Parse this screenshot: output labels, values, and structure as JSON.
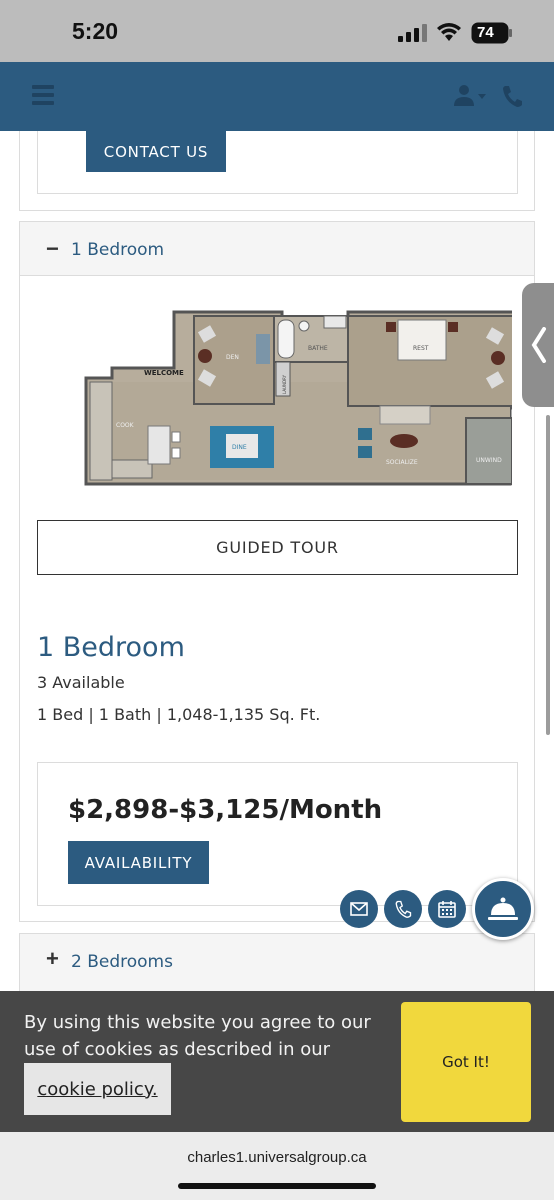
{
  "status_bar": {
    "time": "5:20",
    "battery": "74"
  },
  "contact_card": {
    "contact_label": "CONTACT US"
  },
  "accordion_1": {
    "sign": "−",
    "title": "1 Bedroom",
    "floorplan_labels": [
      "WELCOME",
      "DEN",
      "BATHE",
      "REST",
      "LAUNDRY",
      "COOK",
      "DINE",
      "SOCIALIZE",
      "UNWIND"
    ],
    "tour_label": "GUIDED TOUR",
    "plan_name": "1 Bedroom",
    "available": "3 Available",
    "specs": "1 Bed | 1 Bath | 1,048-1,135 Sq. Ft.",
    "price": "$2,898-$3,125/Month",
    "availability_label": "AVAILABILITY"
  },
  "accordion_2": {
    "sign": "+",
    "title": "2 Bedrooms"
  },
  "floating_buttons": [
    "mail-icon",
    "phone-icon",
    "calendar-icon",
    "concierge-bell-icon"
  ],
  "cookie_banner": {
    "text": "By using this website you agree to our use of cookies as described in our",
    "link": "cookie policy.",
    "button": "Got It!"
  },
  "browser": {
    "url": "charles1.universalgroup.ca"
  },
  "colors": {
    "brand": "#2c5b80",
    "cookie_bg": "#474747",
    "got_it": "#f1d83d"
  }
}
